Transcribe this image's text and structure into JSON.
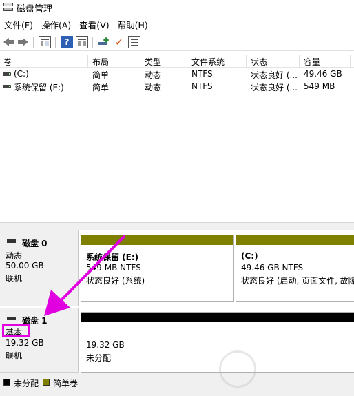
{
  "window": {
    "title": "磁盘管理"
  },
  "menu": [
    "文件(F)",
    "操作(A)",
    "查看(V)",
    "帮助(H)"
  ],
  "toolbar": {
    "icons": [
      "back-arrow-icon",
      "forward-arrow-icon",
      "console-tree-icon",
      "help-icon",
      "properties-icon",
      "connect-icon",
      "check-icon",
      "list-icon"
    ]
  },
  "volume_table": {
    "columns": [
      "卷",
      "布局",
      "类型",
      "文件系统",
      "状态",
      "容量"
    ],
    "rows": [
      {
        "volume": "(C:)",
        "layout": "简单",
        "type": "动态",
        "fs": "NTFS",
        "status": "状态良好 (...",
        "capacity": "49.46 GB"
      },
      {
        "volume": "系统保留 (E:)",
        "layout": "简单",
        "type": "动态",
        "fs": "NTFS",
        "status": "状态良好 (...",
        "capacity": "549 MB"
      }
    ]
  },
  "disks": [
    {
      "name": "磁盘 0",
      "type": "动态",
      "size": "50.00 GB",
      "state": "联机",
      "partitions": [
        {
          "title": "系统保留 (E:)",
          "size": "549 MB NTFS",
          "status": "状态良好 (系统)",
          "bar_color": "#808000"
        },
        {
          "title": "(C:)",
          "size": "49.46 GB NTFS",
          "status": "状态良好 (启动, 页面文件, 故障",
          "bar_color": "#808000"
        }
      ]
    },
    {
      "name": "磁盘 1",
      "type": "基本",
      "size": "19.32 GB",
      "state": "联机",
      "partitions": [
        {
          "title": "",
          "size": "19.32 GB",
          "status": "未分配",
          "bar_color": "#000000"
        }
      ]
    }
  ],
  "legend": [
    {
      "label": "未分配",
      "color": "#000000"
    },
    {
      "label": "简单卷",
      "color": "#808000"
    }
  ],
  "annotation": {
    "highlight_color": "#e000e0"
  },
  "watermark": {
    "brand_color": "#c8c8c8"
  }
}
